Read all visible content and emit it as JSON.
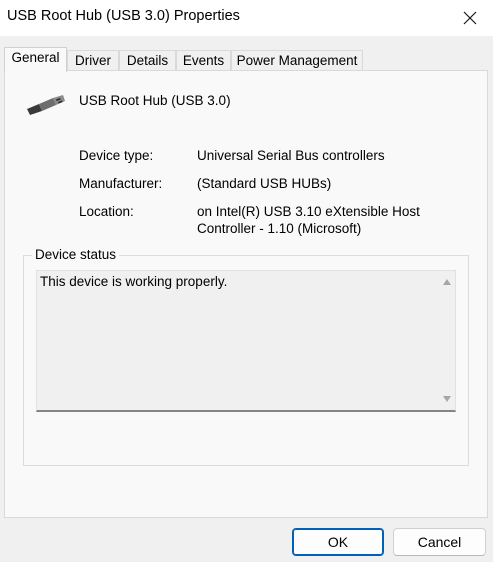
{
  "window": {
    "title": "USB Root Hub (USB 3.0) Properties",
    "close_icon": "close-icon"
  },
  "tabs": [
    {
      "label": "General",
      "active": true
    },
    {
      "label": "Driver",
      "active": false
    },
    {
      "label": "Details",
      "active": false
    },
    {
      "label": "Events",
      "active": false
    },
    {
      "label": "Power Management",
      "active": false
    }
  ],
  "general": {
    "device_icon": "usb-plug-icon",
    "device_name": "USB Root Hub (USB 3.0)",
    "properties": [
      {
        "label": "Device type:",
        "value": "Universal Serial Bus controllers"
      },
      {
        "label": "Manufacturer:",
        "value": "(Standard USB HUBs)"
      },
      {
        "label": "Location:",
        "value": "on Intel(R) USB 3.10 eXtensible Host Controller - 1.10 (Microsoft)"
      }
    ],
    "device_status": {
      "legend": "Device status",
      "text": "This device is working properly."
    }
  },
  "buttons": {
    "ok": "OK",
    "cancel": "Cancel"
  },
  "colors": {
    "accent": "#005fb8",
    "window_bg": "#f0f0f0",
    "panel_bg": "#f9f9f9"
  }
}
